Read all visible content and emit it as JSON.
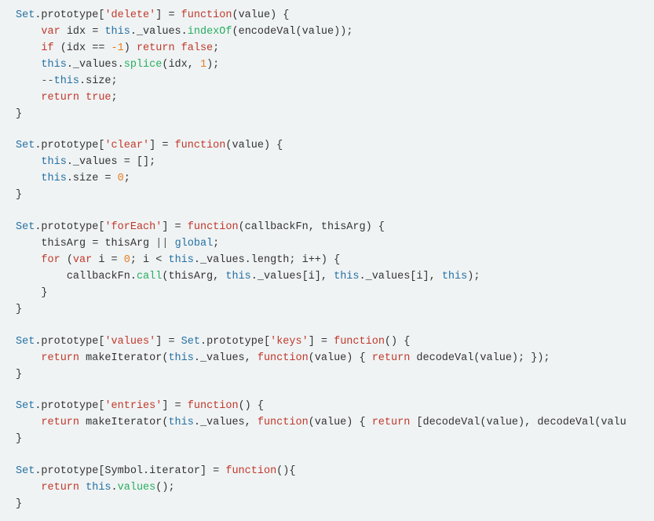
{
  "code": {
    "lines": [
      {
        "tokens": [
          {
            "t": "Set",
            "c": "obj"
          },
          {
            "t": ".prototype[",
            "c": "plain"
          },
          {
            "t": "'delete'",
            "c": "str"
          },
          {
            "t": "] = ",
            "c": "plain"
          },
          {
            "t": "function",
            "c": "kw"
          },
          {
            "t": "(value) {",
            "c": "plain"
          }
        ]
      },
      {
        "tokens": [
          {
            "t": "    ",
            "c": "plain"
          },
          {
            "t": "var",
            "c": "kw"
          },
          {
            "t": " idx = ",
            "c": "plain"
          },
          {
            "t": "this",
            "c": "obj"
          },
          {
            "t": "._values.",
            "c": "plain"
          },
          {
            "t": "indexOf",
            "c": "method"
          },
          {
            "t": "(",
            "c": "plain"
          },
          {
            "t": "encodeVal",
            "c": "plain"
          },
          {
            "t": "(value));",
            "c": "plain"
          }
        ]
      },
      {
        "tokens": [
          {
            "t": "    ",
            "c": "plain"
          },
          {
            "t": "if",
            "c": "kw"
          },
          {
            "t": " (idx == ",
            "c": "plain"
          },
          {
            "t": "-1",
            "c": "num"
          },
          {
            "t": ") ",
            "c": "plain"
          },
          {
            "t": "return",
            "c": "kw"
          },
          {
            "t": " ",
            "c": "plain"
          },
          {
            "t": "false",
            "c": "bool"
          },
          {
            "t": ";",
            "c": "plain"
          }
        ]
      },
      {
        "tokens": [
          {
            "t": "    ",
            "c": "plain"
          },
          {
            "t": "this",
            "c": "obj"
          },
          {
            "t": "._values.",
            "c": "plain"
          },
          {
            "t": "splice",
            "c": "method"
          },
          {
            "t": "(idx, ",
            "c": "plain"
          },
          {
            "t": "1",
            "c": "num"
          },
          {
            "t": ");",
            "c": "plain"
          }
        ]
      },
      {
        "tokens": [
          {
            "t": "    ",
            "c": "plain"
          },
          {
            "t": "--",
            "c": "op"
          },
          {
            "t": "this",
            "c": "obj"
          },
          {
            "t": ".size;",
            "c": "plain"
          }
        ]
      },
      {
        "tokens": [
          {
            "t": "    ",
            "c": "plain"
          },
          {
            "t": "return",
            "c": "kw"
          },
          {
            "t": " ",
            "c": "plain"
          },
          {
            "t": "true",
            "c": "bool"
          },
          {
            "t": ";",
            "c": "plain"
          }
        ]
      },
      {
        "tokens": [
          {
            "t": "}",
            "c": "plain"
          }
        ]
      },
      {
        "empty": true
      },
      {
        "tokens": [
          {
            "t": "Set",
            "c": "obj"
          },
          {
            "t": ".prototype[",
            "c": "plain"
          },
          {
            "t": "'clear'",
            "c": "str"
          },
          {
            "t": "] = ",
            "c": "plain"
          },
          {
            "t": "function",
            "c": "kw"
          },
          {
            "t": "(value) {",
            "c": "plain"
          }
        ]
      },
      {
        "tokens": [
          {
            "t": "    ",
            "c": "plain"
          },
          {
            "t": "this",
            "c": "obj"
          },
          {
            "t": "._values = [];",
            "c": "plain"
          }
        ]
      },
      {
        "tokens": [
          {
            "t": "    ",
            "c": "plain"
          },
          {
            "t": "this",
            "c": "obj"
          },
          {
            "t": ".size = ",
            "c": "plain"
          },
          {
            "t": "0",
            "c": "num"
          },
          {
            "t": ";",
            "c": "plain"
          }
        ]
      },
      {
        "tokens": [
          {
            "t": "}",
            "c": "plain"
          }
        ]
      },
      {
        "empty": true
      },
      {
        "tokens": [
          {
            "t": "Set",
            "c": "obj"
          },
          {
            "t": ".prototype[",
            "c": "plain"
          },
          {
            "t": "'forEach'",
            "c": "str"
          },
          {
            "t": "] = ",
            "c": "plain"
          },
          {
            "t": "function",
            "c": "kw"
          },
          {
            "t": "(callbackFn, thisArg) {",
            "c": "plain"
          }
        ]
      },
      {
        "tokens": [
          {
            "t": "    ",
            "c": "plain"
          },
          {
            "t": "thisArg",
            "c": "plain"
          },
          {
            "t": " = ",
            "c": "plain"
          },
          {
            "t": "thisArg",
            "c": "plain"
          },
          {
            "t": " || ",
            "c": "op"
          },
          {
            "t": "global",
            "c": "global"
          },
          {
            "t": ";",
            "c": "plain"
          }
        ]
      },
      {
        "tokens": [
          {
            "t": "    ",
            "c": "plain"
          },
          {
            "t": "for",
            "c": "kw"
          },
          {
            "t": " (",
            "c": "plain"
          },
          {
            "t": "var",
            "c": "kw"
          },
          {
            "t": " i = ",
            "c": "plain"
          },
          {
            "t": "0",
            "c": "num"
          },
          {
            "t": "; i < ",
            "c": "plain"
          },
          {
            "t": "this",
            "c": "obj"
          },
          {
            "t": "._values.length; i++) {",
            "c": "plain"
          }
        ]
      },
      {
        "tokens": [
          {
            "t": "        ",
            "c": "plain"
          },
          {
            "t": "callbackFn",
            "c": "plain"
          },
          {
            "t": ".",
            "c": "plain"
          },
          {
            "t": "call",
            "c": "method"
          },
          {
            "t": "(thisArg, ",
            "c": "plain"
          },
          {
            "t": "this",
            "c": "obj"
          },
          {
            "t": "._values[i], ",
            "c": "plain"
          },
          {
            "t": "this",
            "c": "obj"
          },
          {
            "t": "._values[i], ",
            "c": "plain"
          },
          {
            "t": "this",
            "c": "obj"
          },
          {
            "t": ");",
            "c": "plain"
          }
        ]
      },
      {
        "tokens": [
          {
            "t": "    }",
            "c": "plain"
          }
        ]
      },
      {
        "tokens": [
          {
            "t": "}",
            "c": "plain"
          }
        ]
      },
      {
        "empty": true
      },
      {
        "tokens": [
          {
            "t": "Set",
            "c": "obj"
          },
          {
            "t": ".prototype[",
            "c": "plain"
          },
          {
            "t": "'values'",
            "c": "str"
          },
          {
            "t": "] = ",
            "c": "plain"
          },
          {
            "t": "Set",
            "c": "obj"
          },
          {
            "t": ".prototype[",
            "c": "plain"
          },
          {
            "t": "'keys'",
            "c": "str"
          },
          {
            "t": "] = ",
            "c": "plain"
          },
          {
            "t": "function",
            "c": "kw"
          },
          {
            "t": "() {",
            "c": "plain"
          }
        ]
      },
      {
        "tokens": [
          {
            "t": "    ",
            "c": "plain"
          },
          {
            "t": "return",
            "c": "kw"
          },
          {
            "t": " makeIterator(",
            "c": "plain"
          },
          {
            "t": "this",
            "c": "obj"
          },
          {
            "t": "._values, ",
            "c": "plain"
          },
          {
            "t": "function",
            "c": "kw"
          },
          {
            "t": "(value) { ",
            "c": "plain"
          },
          {
            "t": "return",
            "c": "kw"
          },
          {
            "t": " decodeVal(value); });",
            "c": "plain"
          }
        ]
      },
      {
        "tokens": [
          {
            "t": "}",
            "c": "plain"
          }
        ]
      },
      {
        "empty": true
      },
      {
        "tokens": [
          {
            "t": "Set",
            "c": "obj"
          },
          {
            "t": ".prototype[",
            "c": "plain"
          },
          {
            "t": "'entries'",
            "c": "str"
          },
          {
            "t": "] = ",
            "c": "plain"
          },
          {
            "t": "function",
            "c": "kw"
          },
          {
            "t": "() {",
            "c": "plain"
          }
        ]
      },
      {
        "tokens": [
          {
            "t": "    ",
            "c": "plain"
          },
          {
            "t": "return",
            "c": "kw"
          },
          {
            "t": " makeIterator(",
            "c": "plain"
          },
          {
            "t": "this",
            "c": "obj"
          },
          {
            "t": "._values, ",
            "c": "plain"
          },
          {
            "t": "function",
            "c": "kw"
          },
          {
            "t": "(value) { ",
            "c": "plain"
          },
          {
            "t": "return",
            "c": "kw"
          },
          {
            "t": " [decodeVal(value), decodeVal(valu",
            "c": "plain"
          }
        ]
      },
      {
        "tokens": [
          {
            "t": "}",
            "c": "plain"
          }
        ]
      },
      {
        "empty": true
      },
      {
        "tokens": [
          {
            "t": "Set",
            "c": "obj"
          },
          {
            "t": ".prototype[Symbol.iterator] = ",
            "c": "plain"
          },
          {
            "t": "function",
            "c": "kw"
          },
          {
            "t": "(){",
            "c": "plain"
          }
        ]
      },
      {
        "tokens": [
          {
            "t": "    ",
            "c": "plain"
          },
          {
            "t": "return",
            "c": "kw"
          },
          {
            "t": " ",
            "c": "plain"
          },
          {
            "t": "this",
            "c": "obj"
          },
          {
            "t": ".",
            "c": "plain"
          },
          {
            "t": "values",
            "c": "method"
          },
          {
            "t": "();",
            "c": "plain"
          }
        ]
      },
      {
        "tokens": [
          {
            "t": "}",
            "c": "plain"
          }
        ]
      }
    ]
  }
}
